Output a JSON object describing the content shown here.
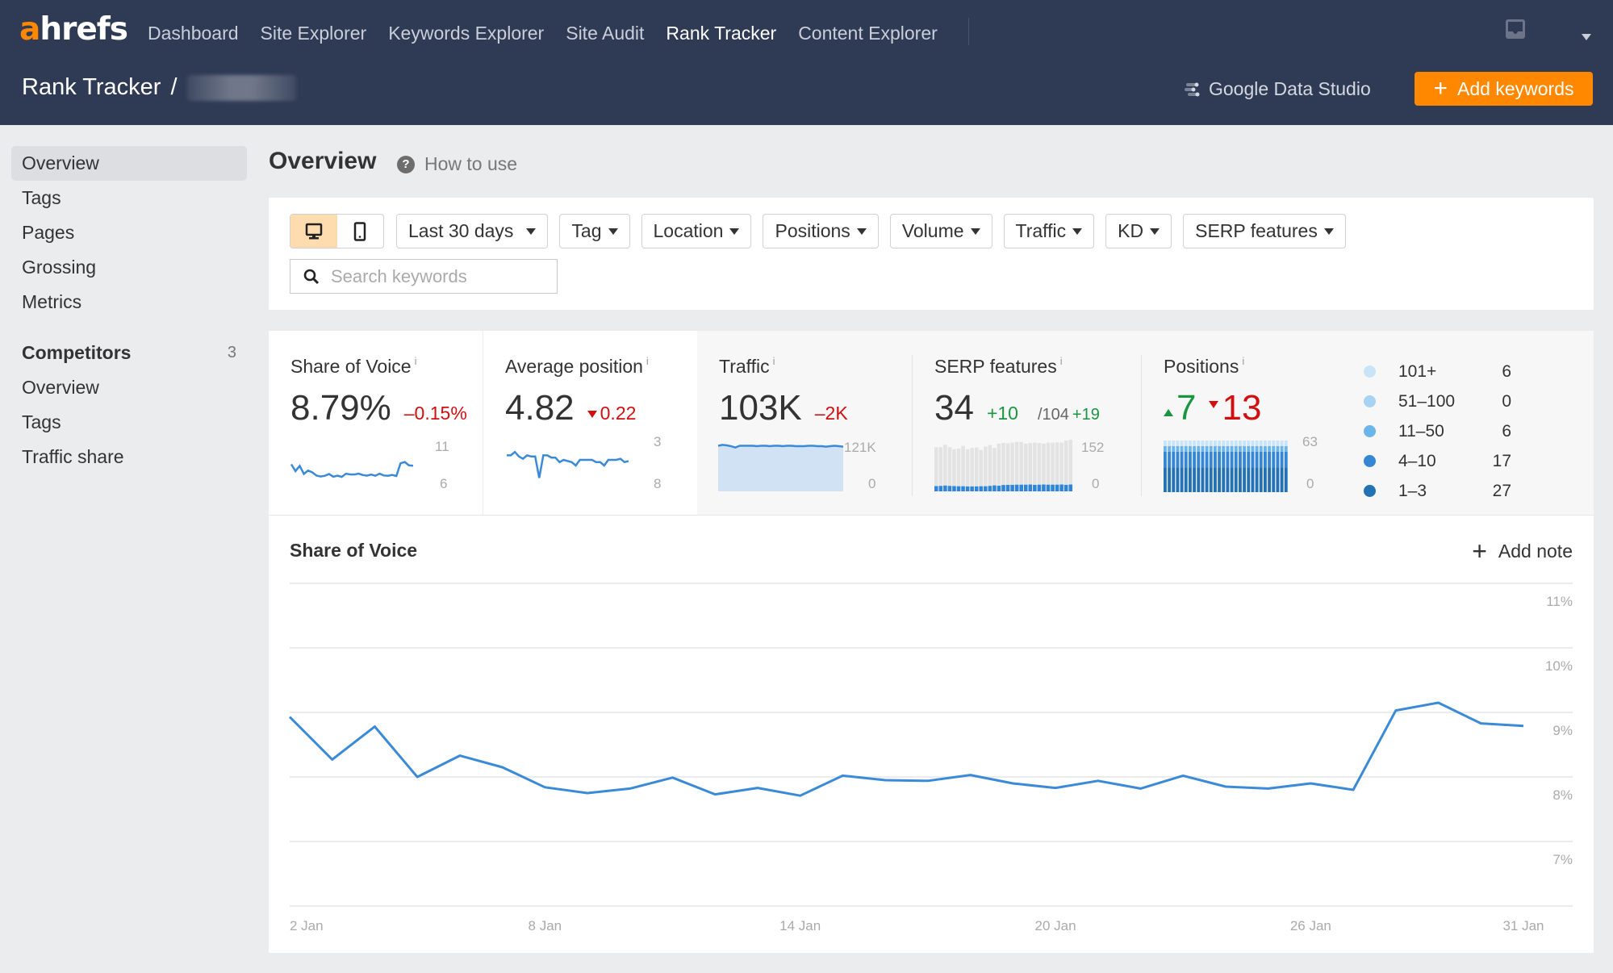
{
  "header": {
    "logo_a": "a",
    "logo_rest": "hrefs",
    "nav": [
      {
        "label": "Dashboard",
        "active": false
      },
      {
        "label": "Site Explorer",
        "active": false
      },
      {
        "label": "Keywords Explorer",
        "active": false
      },
      {
        "label": "Site Audit",
        "active": false
      },
      {
        "label": "Rank Tracker",
        "active": true
      },
      {
        "label": "Content Explorer",
        "active": false
      }
    ],
    "breadcrumb_root": "Rank Tracker",
    "breadcrumb_sep": "/",
    "google_data_studio": "Google Data Studio",
    "add_keywords": "Add keywords",
    "add_keywords_icon": "plus-icon",
    "inbox_icon": "inbox-icon",
    "user_menu_icon": "caret-down-icon"
  },
  "sidebar": {
    "items": [
      {
        "label": "Overview",
        "active": true
      },
      {
        "label": "Tags",
        "active": false
      },
      {
        "label": "Pages",
        "active": false
      },
      {
        "label": "Grossing",
        "active": false
      },
      {
        "label": "Metrics",
        "active": false
      }
    ],
    "competitors": {
      "title": "Competitors",
      "count": "3",
      "items": [
        {
          "label": "Overview"
        },
        {
          "label": "Tags"
        },
        {
          "label": "Traffic share"
        }
      ]
    }
  },
  "page": {
    "title": "Overview",
    "help_label": "How to use",
    "help_icon": "?"
  },
  "filters": {
    "device": {
      "options": [
        "desktop",
        "mobile"
      ],
      "selected": "desktop"
    },
    "buttons": [
      "Last 30 days",
      "Tag",
      "Location",
      "Positions",
      "Volume",
      "Traffic",
      "KD",
      "SERP features"
    ],
    "search_placeholder": "Search keywords",
    "search_value": ""
  },
  "metrics": {
    "share_of_voice": {
      "label": "Share of Voice",
      "info": "i",
      "value": "8.79%",
      "delta": "–0.15%",
      "axis_max": "11",
      "axis_min": "6"
    },
    "average_position": {
      "label": "Average position",
      "info": "i",
      "value": "4.82",
      "delta": "0.22",
      "axis_top": "3",
      "axis_bottom": "8",
      "spark": [
        4.6,
        4.6,
        4.3,
        4.7,
        4.9,
        4.6,
        4.7,
        4.7,
        6.6,
        4.6,
        4.6,
        4.8,
        4.8,
        5.2,
        5.0,
        5.1,
        5.2,
        5.5,
        5.0,
        5.0,
        5.0,
        5.0,
        5.2,
        5.2,
        5.5,
        5.0,
        5.0,
        5.0,
        4.9,
        5.2,
        5.1
      ]
    },
    "traffic": {
      "label": "Traffic",
      "info": "i",
      "value": "103K",
      "delta": "–2K",
      "axis_max": "121K",
      "axis_min": "0",
      "spark": [
        105,
        107,
        106,
        104,
        101,
        105,
        105,
        105,
        105,
        104,
        105,
        105,
        104,
        105,
        105,
        104,
        105,
        105,
        104,
        104,
        104,
        105,
        105,
        104,
        104,
        103,
        104,
        105,
        104,
        103
      ]
    },
    "serp_features": {
      "label": "SERP features",
      "info": "i",
      "value": "34",
      "delta": "+10",
      "total": "/104",
      "total_delta": "+19",
      "axis_max": "152",
      "axis_min": "0",
      "owned": [
        30,
        31,
        33,
        31,
        30,
        29,
        29,
        28,
        28,
        28,
        29,
        29,
        31,
        34,
        32,
        36,
        37,
        37,
        38,
        38,
        38,
        39,
        37,
        38,
        39,
        38,
        38,
        38,
        39,
        37,
        39
      ],
      "total_series": [
        126,
        126,
        133,
        126,
        120,
        122,
        130,
        120,
        124,
        125,
        118,
        128,
        132,
        124,
        136,
        138,
        137,
        139,
        141,
        141,
        136,
        138,
        139,
        138,
        136,
        139,
        139,
        140,
        139,
        145,
        147
      ]
    },
    "positions": {
      "label": "Positions",
      "info": "i",
      "up": "7",
      "down": "13",
      "axis_max": "63",
      "axis_min": "0",
      "legend": [
        {
          "label": "101+",
          "value": "6",
          "color": "#c9e4f7"
        },
        {
          "label": "51–100",
          "value": "0",
          "color": "#a8d2f2"
        },
        {
          "label": "11–50",
          "value": "6",
          "color": "#6bb5ea"
        },
        {
          "label": "4–10",
          "value": "17",
          "color": "#3587d6"
        },
        {
          "label": "1–3",
          "value": "27",
          "color": "#2472b3"
        }
      ]
    }
  },
  "chart_data": {
    "type": "line",
    "title": "Share of Voice",
    "add_note_label": "Add note",
    "xlabel": "",
    "ylabel": "",
    "ylim": [
      6,
      11
    ],
    "y_ticks": [
      "11%",
      "10%",
      "9%",
      "8%",
      "7%"
    ],
    "y_tick_values": [
      11,
      10,
      9,
      8,
      7
    ],
    "grid": true,
    "x": [
      "1 Jan",
      "2 Jan",
      "3 Jan",
      "4 Jan",
      "5 Jan",
      "6 Jan",
      "7 Jan",
      "8 Jan",
      "9 Jan",
      "10 Jan",
      "11 Jan",
      "12 Jan",
      "13 Jan",
      "14 Jan",
      "15 Jan",
      "16 Jan",
      "17 Jan",
      "18 Jan",
      "19 Jan",
      "20 Jan",
      "21 Jan",
      "22 Jan",
      "23 Jan",
      "24 Jan",
      "25 Jan",
      "26 Jan",
      "27 Jan",
      "28 Jan",
      "29 Jan",
      "30 Jan",
      "31 Jan"
    ],
    "x_tick_labels": [
      {
        "index": 1,
        "label": "2 Jan"
      },
      {
        "index": 7,
        "label": "8 Jan"
      },
      {
        "index": 13,
        "label": "14 Jan"
      },
      {
        "index": 19,
        "label": "20 Jan"
      },
      {
        "index": 25,
        "label": "26 Jan"
      },
      {
        "index": 30,
        "label": "31 Jan"
      }
    ],
    "series": [
      {
        "name": "Share of Voice",
        "color": "#3b8ad8",
        "values": [
          8.93,
          8.27,
          8.78,
          8.0,
          8.33,
          8.15,
          7.84,
          7.75,
          7.82,
          7.99,
          7.73,
          7.83,
          7.71,
          8.02,
          7.95,
          7.94,
          8.03,
          7.9,
          7.83,
          7.94,
          7.82,
          8.02,
          7.85,
          7.82,
          7.9,
          7.8,
          9.03,
          9.15,
          8.83,
          8.79
        ]
      }
    ]
  }
}
